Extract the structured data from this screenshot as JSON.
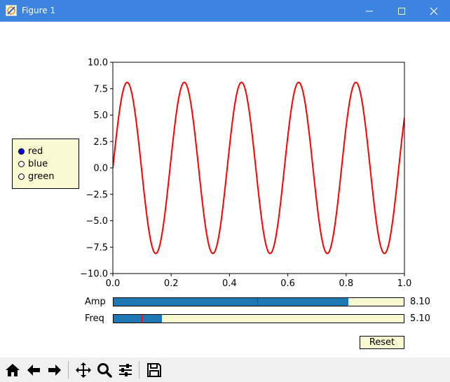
{
  "window": {
    "title": "Figure 1"
  },
  "radio": {
    "items": [
      {
        "label": "red",
        "selected": true
      },
      {
        "label": "blue",
        "selected": false
      },
      {
        "label": "green",
        "selected": false
      }
    ],
    "selected_color": "#0000ff"
  },
  "sliders": {
    "amp": {
      "label": "Amp",
      "value_text": "8.10",
      "value": 8.1,
      "init": 5.0,
      "min": 0.1,
      "max": 10.0
    },
    "freq": {
      "label": "Freq",
      "value_text": "5.10",
      "value": 5.1,
      "init": 3.0,
      "min": 0.1,
      "max": 30.0
    }
  },
  "reset_label": "Reset",
  "toolbar": {
    "icons": [
      "home-icon",
      "back-arrow-icon",
      "forward-arrow-icon",
      "pan-icon",
      "zoom-icon",
      "configure-subplots-icon",
      "save-icon"
    ]
  },
  "chart_data": {
    "type": "line",
    "function": "amplitude * sin(2*pi*frequency*t)",
    "amplitude": 8.1,
    "frequency": 5.1,
    "x_range": [
      0.0,
      1.0
    ],
    "series": [
      {
        "color": "#ff0000",
        "linewidth": 2
      }
    ],
    "xlim": [
      0.0,
      1.0
    ],
    "ylim": [
      -10.0,
      10.0
    ],
    "xticks": [
      0.0,
      0.2,
      0.4,
      0.6,
      0.8,
      1.0
    ],
    "xtick_labels": [
      "0.0",
      "0.2",
      "0.4",
      "0.6",
      "0.8",
      "1.0"
    ],
    "yticks": [
      10.0,
      7.5,
      5.0,
      2.5,
      0.0,
      -2.5,
      -5.0,
      -7.5,
      -10.0
    ],
    "ytick_labels": [
      "10.0",
      "7.5",
      "5.0",
      "2.5",
      "0.0",
      "−2.5",
      "−5.0",
      "−7.5",
      "−10.0"
    ],
    "grid": false
  }
}
